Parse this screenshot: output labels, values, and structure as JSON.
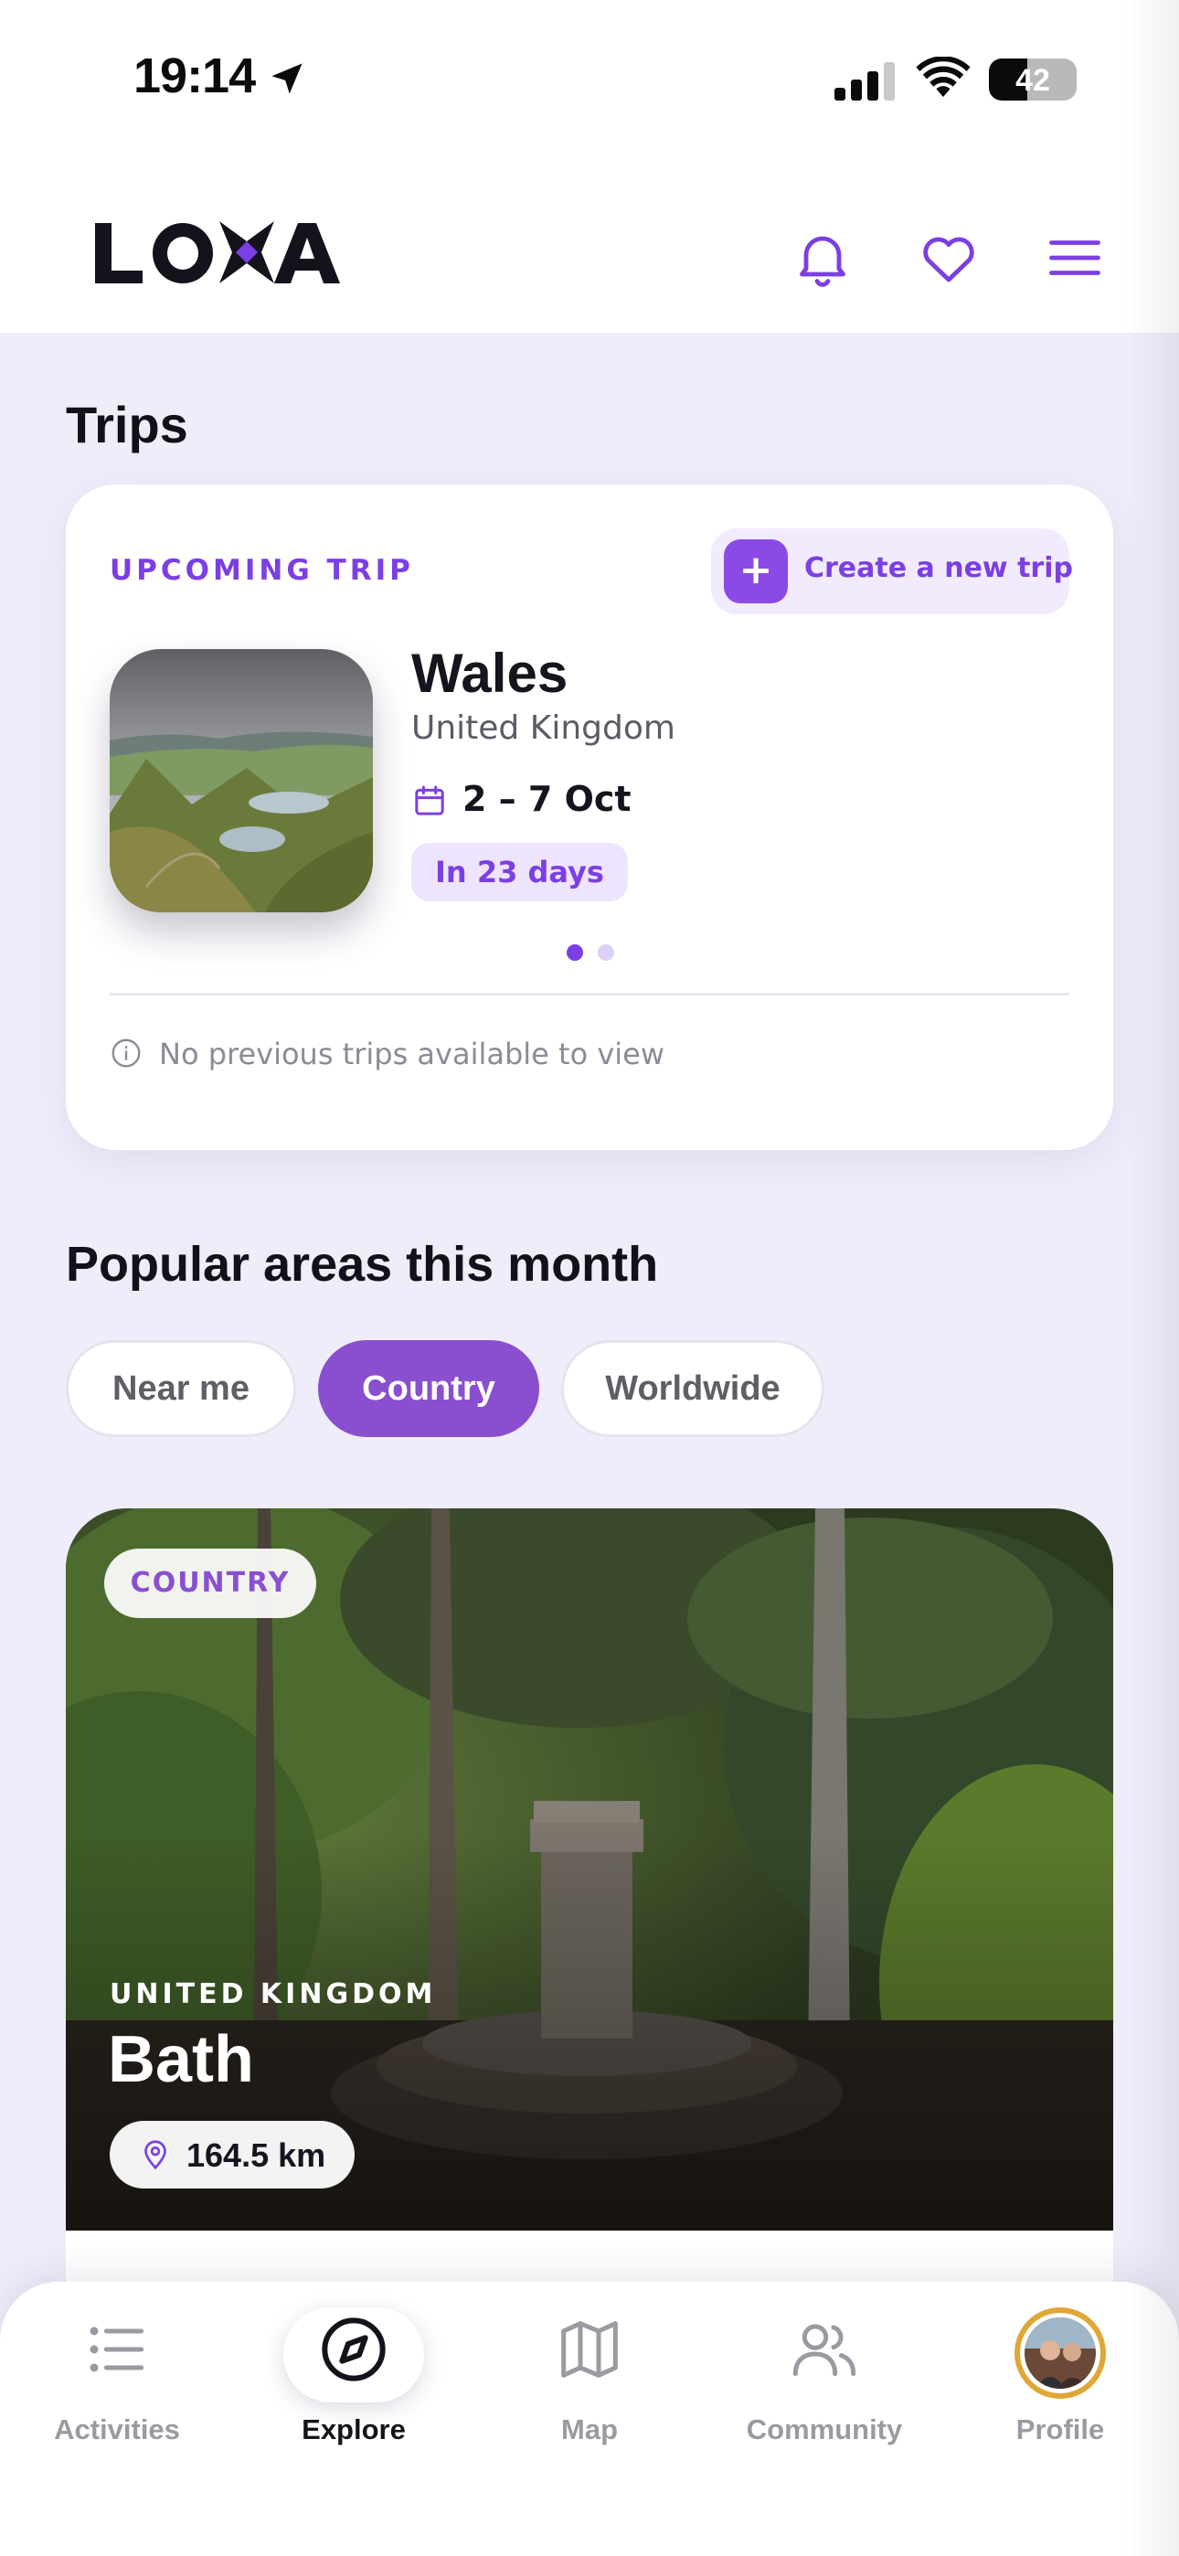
{
  "status_bar": {
    "time": "19:14",
    "battery": "42"
  },
  "header": {
    "logo_text": "LOXA",
    "icons": [
      "bell-icon",
      "heart-icon",
      "menu-icon"
    ],
    "brand_color": "#7b3fe4"
  },
  "trips": {
    "title": "Trips",
    "upcoming_label": "UPCOMING TRIP",
    "create_label": "Create a new trip",
    "trip": {
      "name": "Wales",
      "country": "United Kingdom",
      "dates": "2 – 7 Oct",
      "countdown": "In 23 days"
    },
    "carousel": {
      "count": 2,
      "active": 1
    },
    "no_previous": "No previous trips available to view"
  },
  "popular": {
    "title": "Popular areas this month",
    "filters": [
      {
        "label": "Near me",
        "active": false
      },
      {
        "label": "Country",
        "active": true
      },
      {
        "label": "Worldwide",
        "active": false
      }
    ],
    "card": {
      "badge": "COUNTRY",
      "country": "UNITED KINGDOM",
      "name": "Bath",
      "distance": "164.5 km"
    }
  },
  "bottom_nav": {
    "items": [
      {
        "label": "Activities",
        "icon": "list-icon",
        "active": false
      },
      {
        "label": "Explore",
        "icon": "compass-icon",
        "active": true
      },
      {
        "label": "Map",
        "icon": "map-icon",
        "active": false
      },
      {
        "label": "Community",
        "icon": "community-icon",
        "active": false
      },
      {
        "label": "Profile",
        "icon": "avatar",
        "active": false
      }
    ]
  }
}
